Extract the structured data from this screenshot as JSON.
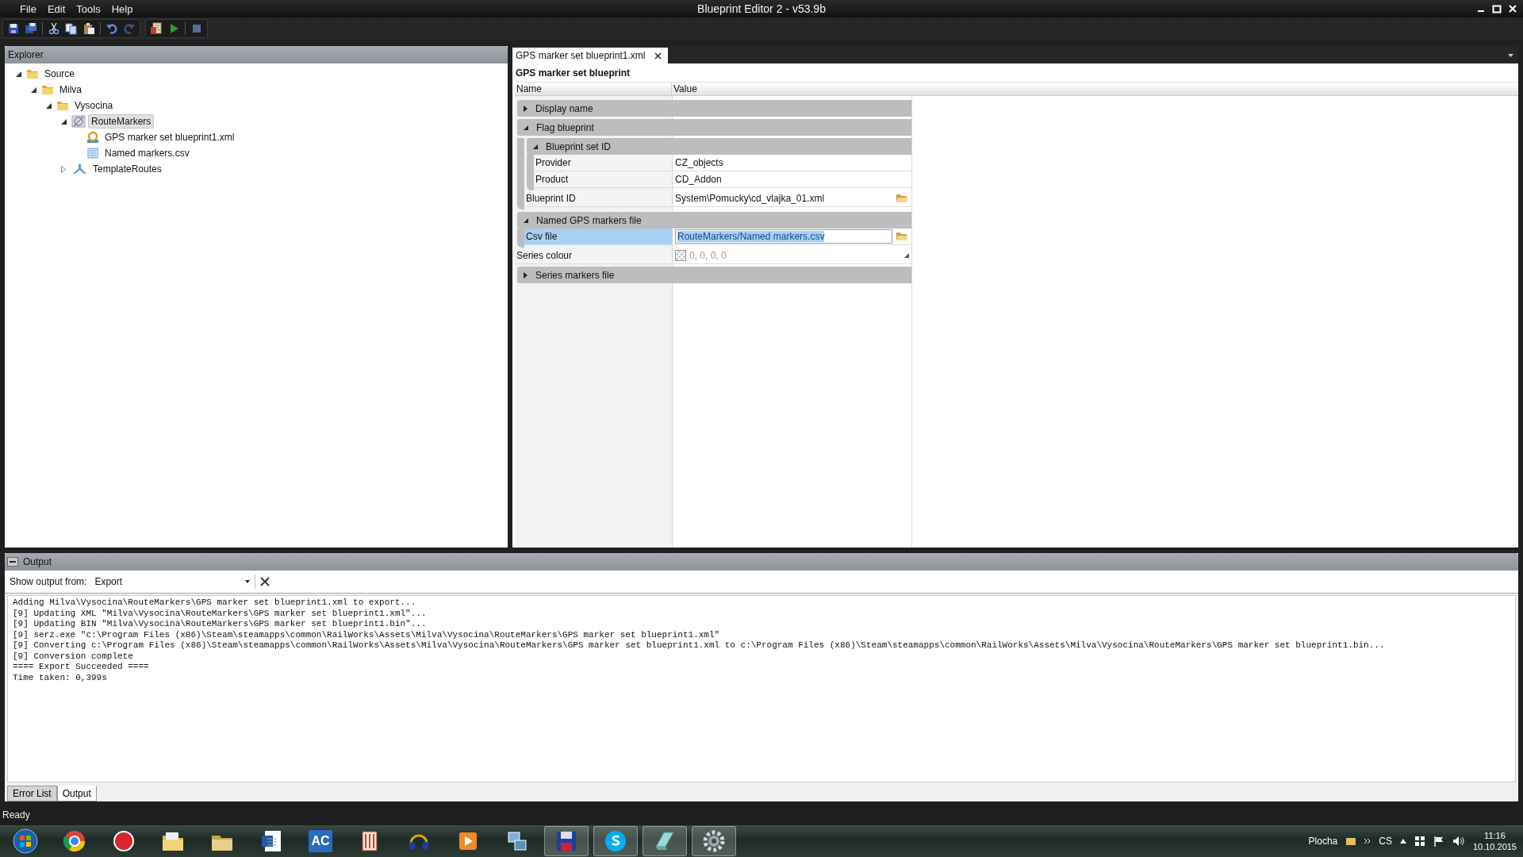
{
  "window": {
    "title": "Blueprint Editor 2 - v53.9b"
  },
  "menu": [
    "File",
    "Edit",
    "Tools",
    "Help"
  ],
  "explorer": {
    "title": "Explorer",
    "tree": [
      {
        "label": "Source",
        "kind": "folder",
        "expanded": true,
        "selected": false,
        "children": [
          {
            "label": "Milva",
            "kind": "folder",
            "expanded": true,
            "selected": false,
            "children": [
              {
                "label": "Vysocina",
                "kind": "folder",
                "expanded": true,
                "selected": false,
                "children": [
                  {
                    "label": "RouteMarkers",
                    "kind": "route",
                    "expanded": true,
                    "selected": true,
                    "children": [
                      {
                        "label": "GPS marker set blueprint1.xml",
                        "kind": "blueprint",
                        "selected": false
                      },
                      {
                        "label": "Named markers.csv",
                        "kind": "csv",
                        "selected": false
                      }
                    ]
                  },
                  {
                    "label": "TemplateRoutes",
                    "kind": "template",
                    "expanded": false,
                    "selected": false
                  }
                ]
              }
            ]
          }
        ]
      }
    ]
  },
  "document": {
    "tabs": [
      {
        "label": "GPS marker set blueprint1.xml",
        "selected": true
      }
    ],
    "heading": "GPS marker set blueprint",
    "columns": [
      "Name",
      "Value"
    ],
    "properties": [
      {
        "kind": "category",
        "name": "Display name",
        "expanded": false
      },
      {
        "kind": "category",
        "name": "Flag blueprint",
        "expanded": true,
        "children": [
          {
            "kind": "category",
            "name": "Blueprint set ID",
            "expanded": true,
            "children": [
              {
                "kind": "text",
                "name": "Provider",
                "value": "CZ_objects",
                "selected": false
              },
              {
                "kind": "text",
                "name": "Product",
                "value": "CD_Addon",
                "selected": false
              }
            ]
          },
          {
            "kind": "file",
            "name": "Blueprint ID",
            "value": "System\\Pomucky\\cd_vlajka_01.xml",
            "selected": false
          }
        ]
      },
      {
        "kind": "category",
        "name": "Named GPS markers file",
        "expanded": true,
        "children": [
          {
            "kind": "file",
            "name": "Csv file",
            "value": "RouteMarkers/Named markers.csv",
            "selected": true
          }
        ]
      },
      {
        "kind": "color",
        "name": "Series colour",
        "value": "0, 0, 0, 0",
        "selected": false
      },
      {
        "kind": "category",
        "name": "Series markers file",
        "expanded": false
      }
    ]
  },
  "output": {
    "title": "Output",
    "source_label": "Show output from:",
    "source": "Export",
    "lines": [
      "Adding Milva\\Vysocina\\RouteMarkers\\GPS marker set blueprint1.xml to export...",
      "[9] Updating XML \"Milva\\Vysocina\\RouteMarkers\\GPS marker set blueprint1.xml\"...",
      "[9] Updating BIN \"Milva\\Vysocina\\RouteMarkers\\GPS marker set blueprint1.bin\"...",
      "[9] serz.exe \"c:\\Program Files (x86)\\Steam\\steamapps\\common\\RailWorks\\Assets\\Milva\\Vysocina\\RouteMarkers\\GPS marker set blueprint1.xml\"",
      "[9] Converting c:\\Program Files (x86)\\Steam\\steamapps\\common\\RailWorks\\Assets\\Milva\\Vysocina\\RouteMarkers\\GPS marker set blueprint1.xml to c:\\Program Files (x86)\\Steam\\steamapps\\common\\RailWorks\\Assets\\Milva\\Vysocina\\RouteMarkers\\GPS marker set blueprint1.bin...",
      "[9] Conversion complete",
      "==== Export Succeeded ====",
      "Time taken: 0,399s"
    ],
    "tabs": [
      {
        "label": "Error List",
        "selected": false
      },
      {
        "label": "Output",
        "selected": true
      }
    ]
  },
  "status_bar": "Ready",
  "taskbar": {
    "apps": [
      {
        "kind": "start",
        "running": false
      },
      {
        "kind": "browser",
        "running": false
      },
      {
        "kind": "red-s",
        "running": false
      },
      {
        "kind": "files",
        "running": false
      },
      {
        "kind": "folder",
        "running": false
      },
      {
        "kind": "word",
        "running": false
      },
      {
        "kind": "tile",
        "label": "AC",
        "running": false
      },
      {
        "kind": "paint",
        "running": false
      },
      {
        "kind": "headphones",
        "running": false
      },
      {
        "kind": "media",
        "running": false
      },
      {
        "kind": "network",
        "running": false
      },
      {
        "kind": "floppy",
        "running": true
      },
      {
        "kind": "skype",
        "running": true
      },
      {
        "kind": "notepad",
        "running": true
      },
      {
        "kind": "gear",
        "running": true
      }
    ],
    "desktop": "Plocha",
    "language": "CS",
    "time": "11:16",
    "date": "10.10.2015"
  }
}
